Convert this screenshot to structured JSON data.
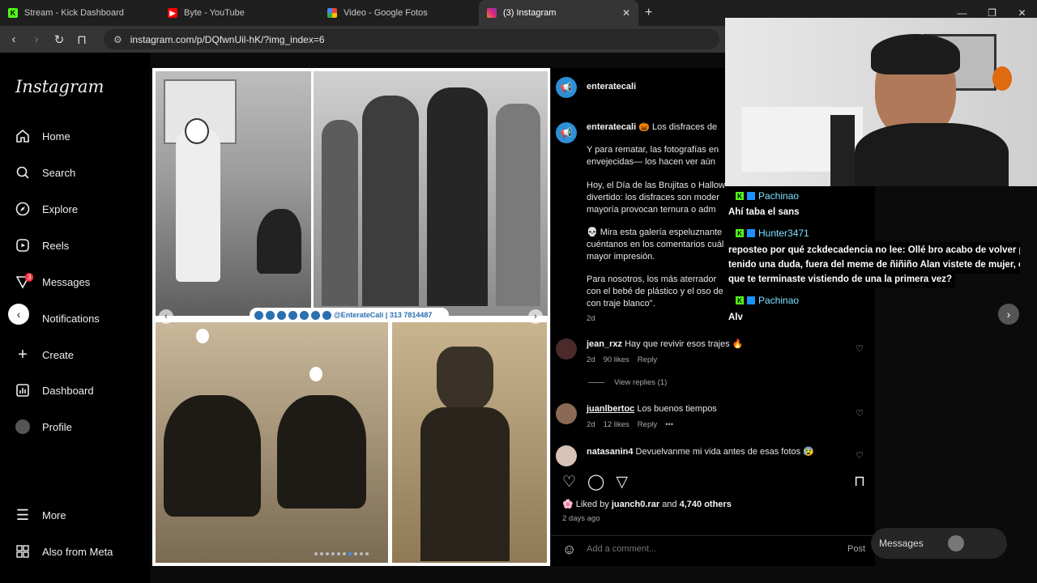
{
  "browser": {
    "tabs": [
      {
        "title": "Stream - Kick Dashboard",
        "favicon_color": "#53fc18"
      },
      {
        "title": "Byte - YouTube",
        "favicon_color": "#ff0000"
      },
      {
        "title": "Video - Google Fotos",
        "favicon_color": "#fbbc04"
      },
      {
        "title": "(3) Instagram",
        "favicon_color": "#e1306c"
      }
    ],
    "url": "instagram.com/p/DQfwnUil-hK/?img_index=6"
  },
  "sidebar": {
    "logo": "Instagram",
    "items": [
      {
        "label": "Home",
        "icon": "home-icon"
      },
      {
        "label": "Search",
        "icon": "search-icon"
      },
      {
        "label": "Explore",
        "icon": "compass-icon"
      },
      {
        "label": "Reels",
        "icon": "reels-icon"
      },
      {
        "label": "Messages",
        "icon": "messenger-icon",
        "badge": "3"
      },
      {
        "label": "Notifications",
        "icon": "heart-icon"
      },
      {
        "label": "Create",
        "icon": "plus-icon"
      },
      {
        "label": "Dashboard",
        "icon": "dashboard-icon"
      },
      {
        "label": "Profile",
        "icon": "avatar"
      }
    ],
    "more": "More",
    "meta": "Also from Meta"
  },
  "post": {
    "banner_text": "@EnterateCali | 313 7814487",
    "author": "enteratecali",
    "caption_user": "enteratecali",
    "caption_lines": [
      "🎃 Los disfraces de",
      "Y para rematar, las fotografías en",
      "envejecidas— los hacen ver aún",
      "Hoy, el Día de las Brujitas o Hallow",
      "divertido: los disfraces son moder",
      "mayoría provocan ternura o adm",
      "💀 Mira esta galería espeluznante",
      "cuéntanos en los comentarios cuál",
      "mayor impresión.",
      "Para nosotros, los más aterrador",
      "con el bebé de plástico y el oso de",
      "con traje blanco\"."
    ],
    "caption_age": "2d",
    "comments": [
      {
        "user": "jean_rxz",
        "text": "Hay que revivir esos trajes 🔥",
        "age": "2d",
        "likes": "90 likes",
        "reply": "Reply"
      },
      {
        "user": "juanlbertoc",
        "text": "Los buenos tiempos",
        "age": "2d",
        "likes": "12 likes",
        "reply": "Reply"
      },
      {
        "user": "natasanin4",
        "text": "Devuelvanme mi vida antes de esas fotos 😰"
      }
    ],
    "view_replies": "View replies (1)",
    "liked_by": "Liked by",
    "liked_user": "juanch0.rar",
    "liked_and": "and",
    "liked_others": "4,740 others",
    "time_ago": "2 days ago",
    "comment_placeholder": "Add a comment...",
    "post_button": "Post"
  },
  "overlay_chat": [
    {
      "name": "Pachinao"
    },
    {
      "text": "Ahí taba el sans"
    },
    {
      "name": "Hunter3471"
    },
    {
      "text": "reposteo por qué zckdecadencia no lee: Ollé bro acabo de volver p"
    },
    {
      "text": "tenido una duda, fuera del meme de ñiñiño Alan vistete de mujer, c"
    },
    {
      "text": "que te terminaste vistiendo de una la primera vez?"
    },
    {
      "name": "Pachinao"
    },
    {
      "text": "Alv"
    }
  ],
  "messages_button": "Messages"
}
